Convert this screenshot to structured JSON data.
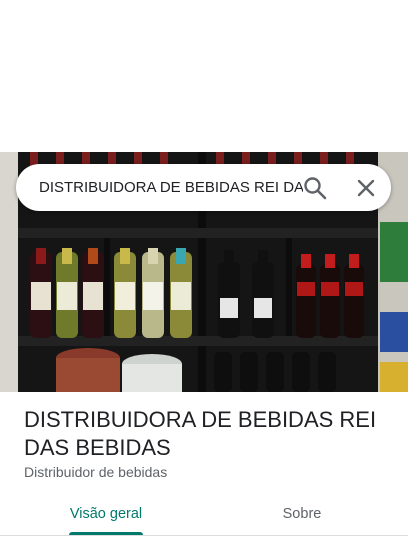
{
  "search": {
    "query": "DISTRIBUIDORA DE BEBIDAS REI DA"
  },
  "icons": {
    "search": "search-icon",
    "close": "close-icon"
  },
  "place": {
    "title": "DISTRIBUIDORA DE BEBIDAS REI DAS BEBIDAS",
    "category": "Distribuidor de bebidas"
  },
  "tabs": [
    {
      "label": "Visão geral",
      "selected": true
    },
    {
      "label": "Sobre",
      "selected": false
    }
  ],
  "colors": {
    "accent": "#00796b",
    "text_primary": "#202124",
    "text_secondary": "#5f6368"
  }
}
